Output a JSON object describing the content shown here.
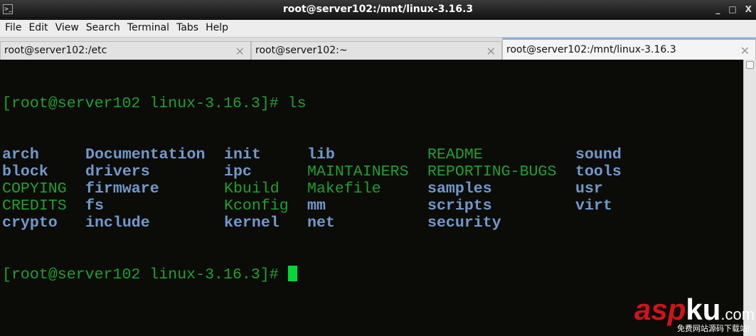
{
  "window": {
    "title": "root@server102:/mnt/linux-3.16.3",
    "controls": [
      "_",
      "□",
      "X"
    ]
  },
  "menu": [
    "File",
    "Edit",
    "View",
    "Search",
    "Terminal",
    "Tabs",
    "Help"
  ],
  "tabs": [
    {
      "label": "root@server102:/etc"
    },
    {
      "label": "root@server102:~"
    },
    {
      "label": "root@server102:/mnt/linux-3.16.3",
      "active": true
    }
  ],
  "terminal": {
    "prompt1": "[root@server102 linux-3.16.3]# ls",
    "ls_rows": [
      [
        {
          "t": "arch",
          "c": "b"
        },
        {
          "t": "Documentation",
          "c": "b"
        },
        {
          "t": "init",
          "c": "b"
        },
        {
          "t": "lib",
          "c": "b"
        },
        {
          "t": "README",
          "c": "g"
        },
        {
          "t": "sound",
          "c": "b"
        }
      ],
      [
        {
          "t": "block",
          "c": "b"
        },
        {
          "t": "drivers",
          "c": "b"
        },
        {
          "t": "ipc",
          "c": "b"
        },
        {
          "t": "MAINTAINERS",
          "c": "g"
        },
        {
          "t": "REPORTING-BUGS",
          "c": "g"
        },
        {
          "t": "tools",
          "c": "b"
        }
      ],
      [
        {
          "t": "COPYING",
          "c": "g"
        },
        {
          "t": "firmware",
          "c": "b"
        },
        {
          "t": "Kbuild",
          "c": "g"
        },
        {
          "t": "Makefile",
          "c": "g"
        },
        {
          "t": "samples",
          "c": "b"
        },
        {
          "t": "usr",
          "c": "b"
        }
      ],
      [
        {
          "t": "CREDITS",
          "c": "g"
        },
        {
          "t": "fs",
          "c": "b"
        },
        {
          "t": "Kconfig",
          "c": "g"
        },
        {
          "t": "mm",
          "c": "b"
        },
        {
          "t": "scripts",
          "c": "b"
        },
        {
          "t": "virt",
          "c": "b"
        }
      ],
      [
        {
          "t": "crypto",
          "c": "b"
        },
        {
          "t": "include",
          "c": "b"
        },
        {
          "t": "kernel",
          "c": "b"
        },
        {
          "t": "net",
          "c": "b"
        },
        {
          "t": "security",
          "c": "b"
        }
      ]
    ],
    "prompt2": "[root@server102 linux-3.16.3]# "
  },
  "watermark": {
    "brand_a": "asp",
    "brand_b": "ku",
    ".com": ".com",
    "slogan": "免费网站源码下载站!"
  }
}
